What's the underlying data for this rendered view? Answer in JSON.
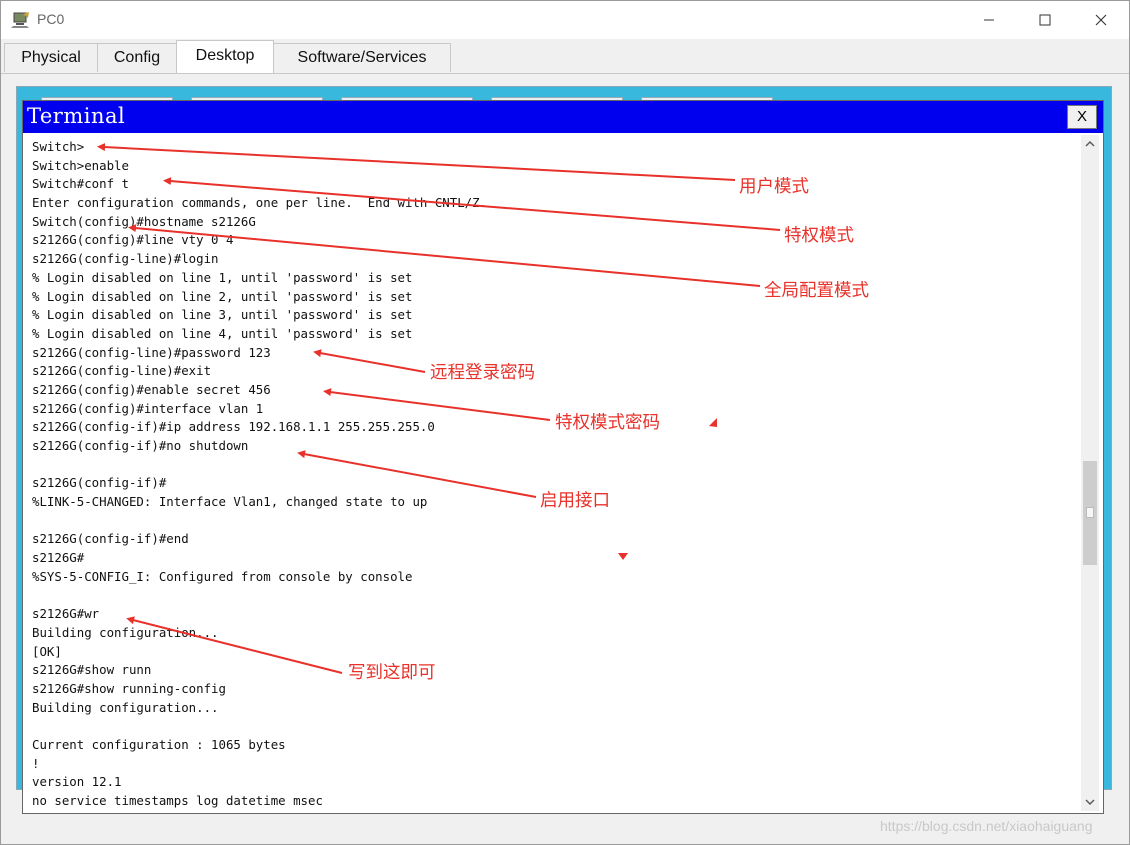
{
  "window": {
    "title": "PC0"
  },
  "tabs": [
    {
      "label": "Physical"
    },
    {
      "label": "Config"
    },
    {
      "label": "Desktop",
      "active": true
    },
    {
      "label": "Software/Services"
    }
  ],
  "terminal": {
    "title": "Terminal",
    "close_label": "X",
    "lines": [
      "Switch>",
      "Switch>enable",
      "Switch#conf t",
      "Enter configuration commands, one per line.  End with CNTL/Z.",
      "Switch(config)#hostname s2126G",
      "s2126G(config)#line vty 0 4",
      "s2126G(config-line)#login",
      "% Login disabled on line 1, until 'password' is set",
      "% Login disabled on line 2, until 'password' is set",
      "% Login disabled on line 3, until 'password' is set",
      "% Login disabled on line 4, until 'password' is set",
      "s2126G(config-line)#password 123",
      "s2126G(config-line)#exit",
      "s2126G(config)#enable secret 456",
      "s2126G(config)#interface vlan 1",
      "s2126G(config-if)#ip address 192.168.1.1 255.255.255.0",
      "s2126G(config-if)#no shutdown",
      "",
      "s2126G(config-if)#",
      "%LINK-5-CHANGED: Interface Vlan1, changed state to up",
      "",
      "s2126G(config-if)#end",
      "s2126G#",
      "%SYS-5-CONFIG_I: Configured from console by console",
      "",
      "s2126G#wr",
      "Building configuration...",
      "[OK]",
      "s2126G#show runn",
      "s2126G#show running-config",
      "Building configuration...",
      "",
      "Current configuration : 1065 bytes",
      "!",
      "version 12.1",
      "no service timestamps log datetime msec"
    ]
  },
  "annotations": {
    "color": "#e8312a",
    "labels": [
      "用户模式",
      "特权模式",
      "全局配置模式",
      "远程登录密码",
      "特权模式密码",
      "启用接口",
      "写到这即可"
    ]
  },
  "watermark": "https://blog.csdn.net/xiaohaiguang",
  "colors": {
    "terminal_header": "#0000ee",
    "desktop_background": "#38b8dc"
  }
}
